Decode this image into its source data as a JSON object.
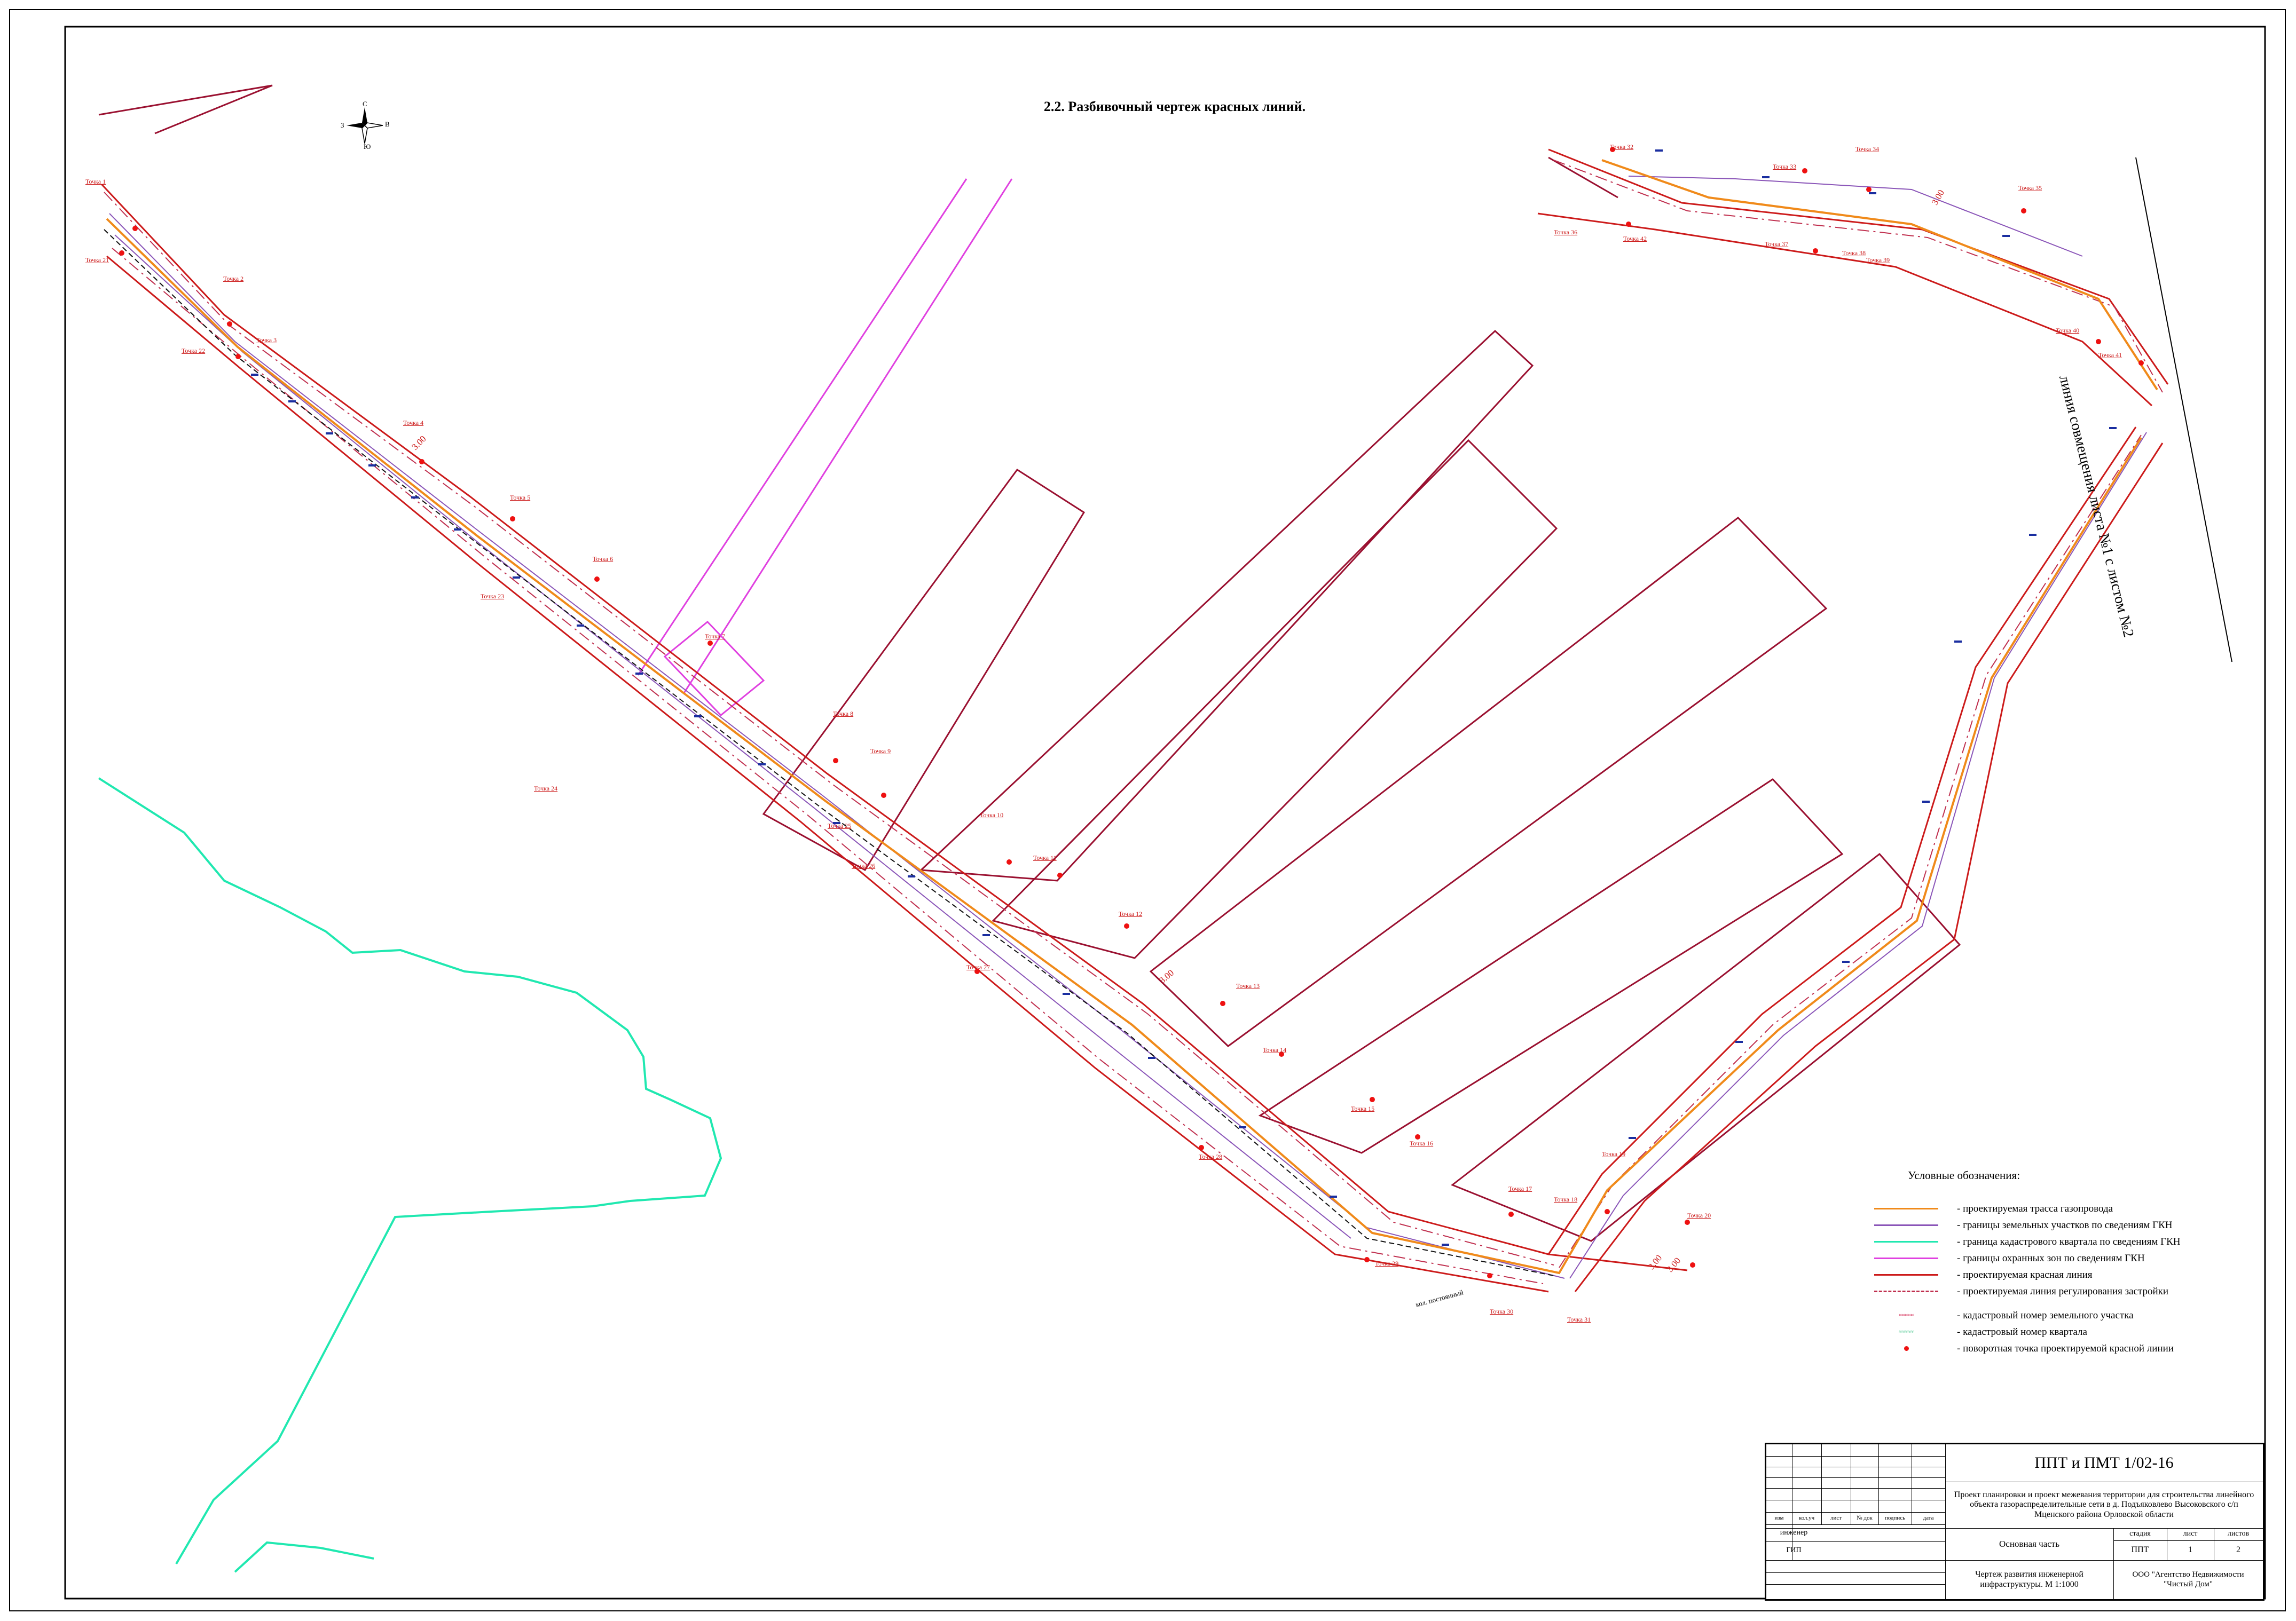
{
  "title": "2.2. Разбивочный чертеж красных линий.",
  "sheet_joint_label": "линия совмещения листа №1 с листом №2",
  "colors": {
    "pipeline": "#f08a1a",
    "parcel_border": "#8a55b8",
    "quarter_border": "#20e8b0",
    "protection_zone": "#e040e0",
    "red_line": "#cc1a1a",
    "building_line": "#c0304f",
    "dark_red": "#9a1030",
    "survey_blue": "#1a2ea0",
    "dot": "#ee1111"
  },
  "compass": {
    "N": "С",
    "E": "В",
    "S": "Ю",
    "W": "З"
  },
  "dimension_labels": [
    "3.00",
    "3.00",
    "3.00",
    "3.00",
    "3.00"
  ],
  "map_labels": {
    "road": "кол. постоянный"
  },
  "points_top": [
    "Точка 1",
    "Точка 2",
    "Точка 3",
    "Точка 4",
    "Точка 5",
    "Точка 6",
    "Точка 7",
    "Точка 8",
    "Точка 9",
    "Точка 10",
    "Точка 11",
    "Точка 12",
    "Точка 13",
    "Точка 14",
    "Точка 15",
    "Точка 16",
    "Точка 17",
    "Точка 18",
    "Точка 19",
    "Точка 20"
  ],
  "points_bottom": [
    "Точка 21",
    "Точка 22",
    "Точка 23",
    "Точка 24",
    "Точка 25",
    "Точка 26",
    "Точка 27",
    "Точка 28",
    "Точка 29",
    "Точка 30",
    "Точка 31"
  ],
  "points_ne": [
    "Точка 32",
    "Точка 33",
    "Точка 34",
    "Точка 35",
    "Точка 36",
    "Точка 37",
    "Точка 38",
    "Точка 39",
    "Точка 40",
    "Точка 41",
    "Точка 42"
  ],
  "legend": {
    "title": "Условные обозначения:",
    "items": [
      {
        "kind": "line",
        "color": "#f08a1a",
        "style": "solid",
        "text": "- проектируемая трасса газопровода"
      },
      {
        "kind": "line",
        "color": "#8a55b8",
        "style": "solid",
        "text": "- границы земельных участков по сведениям ГКН"
      },
      {
        "kind": "line",
        "color": "#20e8b0",
        "style": "solid",
        "text": "- граница кадастрового квартала по сведениям ГКН"
      },
      {
        "kind": "line",
        "color": "#e040e0",
        "style": "solid",
        "text": "- границы охранных зон по сведениям ГКН"
      },
      {
        "kind": "line",
        "color": "#cc1a1a",
        "style": "solid",
        "text": "- проектируемая красная линия"
      },
      {
        "kind": "line",
        "color": "#c0304f",
        "style": "dashdot",
        "text": "- проектируемая линия регулирования застройки"
      },
      {
        "kind": "gap"
      },
      {
        "kind": "tag-red",
        "text": "- кадастровый номер земельного участка"
      },
      {
        "kind": "tag-green",
        "text": "- кадастровый номер квартала"
      },
      {
        "kind": "dot",
        "color": "#ee1111",
        "text": "- поворотная точка проектируемой красной линии"
      }
    ]
  },
  "stamp": {
    "code": "ППТ и ПМТ  1/02-16",
    "project": "Проект планировки и проект межевания территории  для строительства линейного объекта газораспределительные сети в д. Подъяковлево Высоковского с/п Мценского района Орловской области",
    "cols": [
      "изм",
      "кол.уч",
      "лист",
      "№ док",
      "подпись",
      "дата"
    ],
    "role1": "инженер",
    "role2": "ГИП",
    "section": "Основная часть",
    "stage_header": "стадия",
    "sheet_header": "лист",
    "sheets_header": "листов",
    "stage": "ППТ",
    "sheet": "1",
    "sheets": "2",
    "drawing": "Чертеж развития инженерной инфраструктуры. М 1:1000",
    "company": "ООО \"Агентство Недвижимости \"Чистый Дом\""
  }
}
